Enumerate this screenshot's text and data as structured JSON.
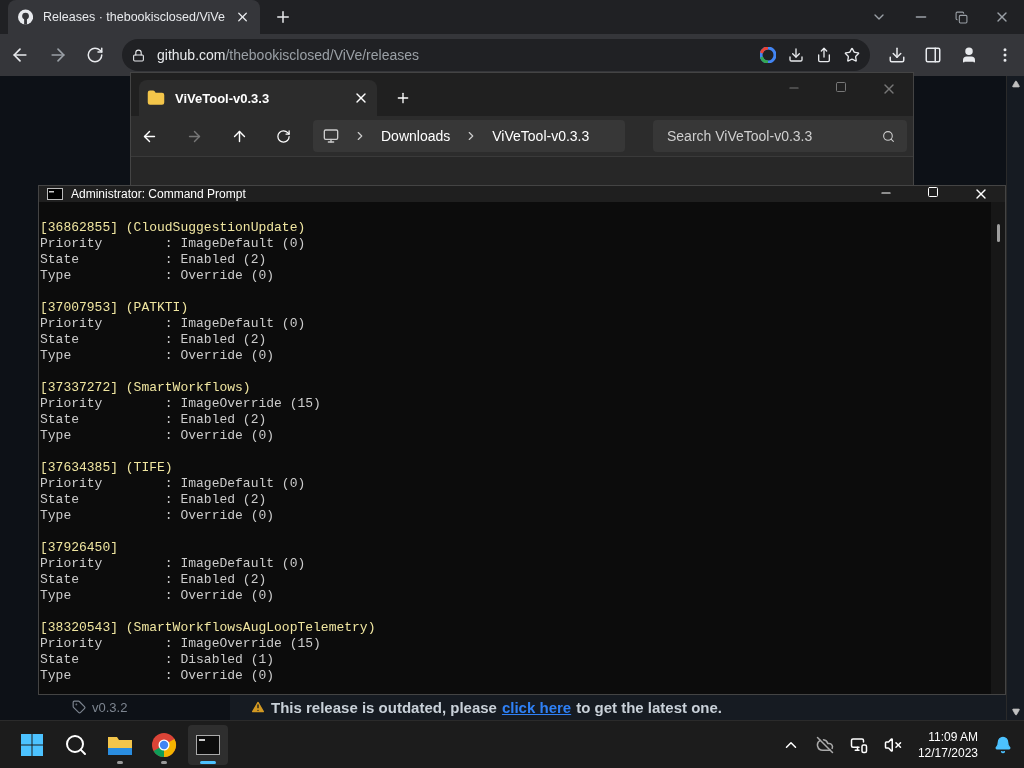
{
  "browser": {
    "tab_title": "Releases · thebookisclosed/ViVe",
    "url_host": "github.com",
    "url_path": "/thebookisclosed/ViVe/releases"
  },
  "page": {
    "tag": "v0.3.2",
    "banner": {
      "before": "This release is outdated, please",
      "link": "click here",
      "after": "to get the latest one."
    }
  },
  "explorer": {
    "tab_title": "ViVeTool-v0.3.3",
    "breadcrumbs": [
      "Downloads",
      "ViVeTool-v0.3.3"
    ],
    "search": {
      "placeholder": "Search ViVeTool-v0.3.3"
    }
  },
  "console": {
    "title": "Administrator: Command Prompt",
    "entries": [
      {
        "header": "[36862855] (CloudSuggestionUpdate)",
        "lines": [
          "Priority        : ImageDefault (0)",
          "State           : Enabled (2)",
          "Type            : Override (0)"
        ]
      },
      {
        "header": "[37007953] (PATKTI)",
        "lines": [
          "Priority        : ImageDefault (0)",
          "State           : Enabled (2)",
          "Type            : Override (0)"
        ]
      },
      {
        "header": "[37337272] (SmartWorkflows)",
        "lines": [
          "Priority        : ImageOverride (15)",
          "State           : Enabled (2)",
          "Type            : Override (0)"
        ]
      },
      {
        "header": "[37634385] (TIFE)",
        "lines": [
          "Priority        : ImageDefault (0)",
          "State           : Enabled (2)",
          "Type            : Override (0)"
        ]
      },
      {
        "header": "[37926450]",
        "lines": [
          "Priority        : ImageDefault (0)",
          "State           : Enabled (2)",
          "Type            : Override (0)"
        ]
      },
      {
        "header": "[38320543] (SmartWorkflowsAugLoopTelemetry)",
        "lines": [
          "Priority        : ImageOverride (15)",
          "State           : Disabled (1)",
          "Type            : Override (0)"
        ]
      }
    ]
  },
  "taskbar": {
    "apps": [
      {
        "kind": "start",
        "running": false,
        "selected": false
      },
      {
        "kind": "search",
        "running": false,
        "selected": false
      },
      {
        "kind": "explorer",
        "running": true,
        "selected": false
      },
      {
        "kind": "chrome",
        "running": true,
        "selected": false
      },
      {
        "kind": "terminal",
        "running": true,
        "selected": true
      }
    ],
    "time": "11:09 AM",
    "date": "12/17/2023"
  }
}
